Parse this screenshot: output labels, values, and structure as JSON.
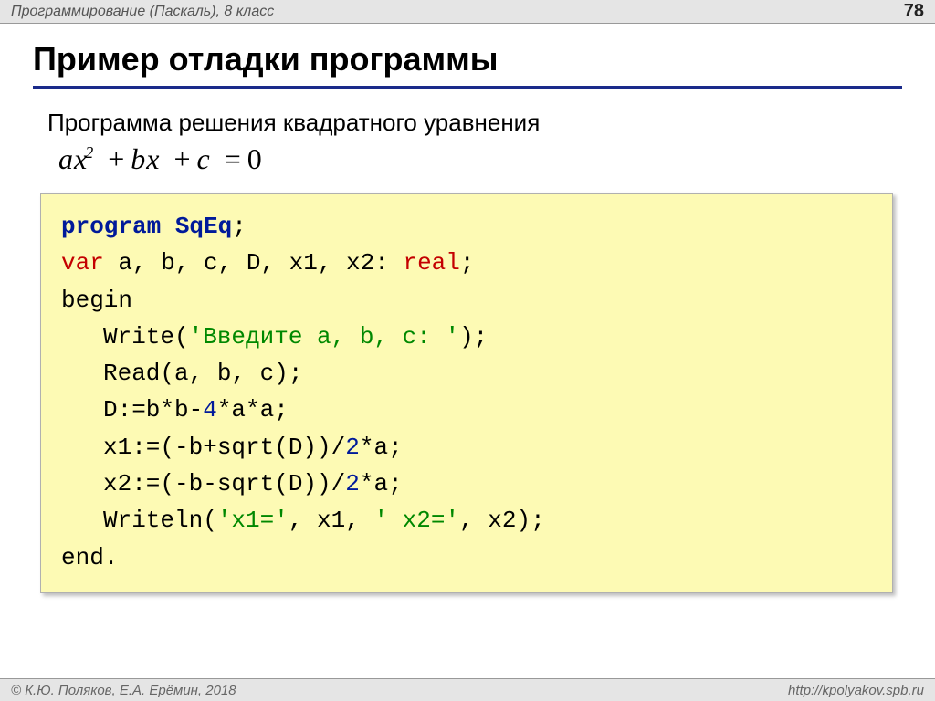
{
  "header": {
    "left": "Программирование (Паскаль), 8 класс",
    "page": "78"
  },
  "title": "Пример отладки программы",
  "subtitle": "Программа решения квадратного уравнения",
  "equation": {
    "a": "a",
    "x": "x",
    "sq": "2",
    "plus1": "+",
    "b": "b",
    "plus2": "+",
    "c": "c",
    "eq": "=",
    "zero": "0"
  },
  "code": {
    "l1_kw": "program",
    "l1_name": "SqEq",
    "l1_end": ";",
    "l2_var": "var",
    "l2_decl": " a, b, c, D, x1, x2: ",
    "l2_type": "real",
    "l2_end": ";",
    "l3": "begin",
    "l4_a": "Write(",
    "l4_str": "'Введите a, b, c: '",
    "l4_b": ");",
    "l5": "Read(a, b, c);",
    "l6_a": "D:=b*b-",
    "l6_n": "4",
    "l6_b": "*a*a;",
    "l7_a": "x1:=(-b+sqrt(D))/",
    "l7_n": "2",
    "l7_b": "*a;",
    "l8_a": "x2:=(-b-sqrt(D))/",
    "l8_n": "2",
    "l8_b": "*a;",
    "l9_a": "Writeln(",
    "l9_s1": "'x1='",
    "l9_m1": ", x1, ",
    "l9_s2": "' x2='",
    "l9_m2": ", x2);",
    "l10": "end."
  },
  "footer": {
    "left": "© К.Ю. Поляков, Е.А. Ерёмин, 2018",
    "right": "http://kpolyakov.spb.ru"
  }
}
